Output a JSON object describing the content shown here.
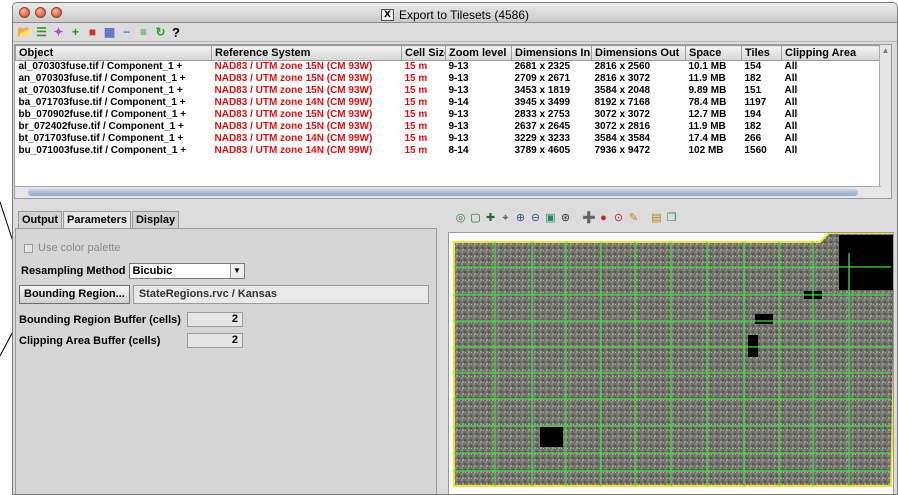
{
  "window": {
    "title": "Export to Tilesets (4586)",
    "x11_glyph": "X"
  },
  "toolbar": {
    "icons": [
      "open-folder-icon",
      "layers-icon",
      "wand-icon",
      "plus-icon",
      "color-blocks-icon",
      "checker-icon",
      "minus-icon",
      "list-icon",
      "refresh-icon"
    ],
    "help": "?"
  },
  "table": {
    "headers": [
      "Object",
      "Reference System",
      "Cell Size",
      "Zoom level",
      "Dimensions In",
      "Dimensions Out",
      "Space",
      "Tiles",
      "Clipping Area"
    ],
    "rows": [
      [
        "al_070303fuse.tif / Component_1 +",
        "NAD83 / UTM zone 15N (CM 93W)",
        "15 m",
        "9-13",
        "2681 x 2325",
        "2816 x 2560",
        "10.1 MB",
        "154",
        "All"
      ],
      [
        "an_070303fuse.tif / Component_1 +",
        "NAD83 / UTM zone 15N (CM 93W)",
        "15 m",
        "9-13",
        "2709 x 2671",
        "2816 x 3072",
        "11.9 MB",
        "182",
        "All"
      ],
      [
        "at_070303fuse.tif / Component_1 +",
        "NAD83 / UTM zone 15N (CM 93W)",
        "15 m",
        "9-13",
        "3453 x 1819",
        "3584 x 2048",
        "9.89 MB",
        "151",
        "All"
      ],
      [
        "ba_071703fuse.tif / Component_1 +",
        "NAD83 / UTM zone 14N (CM 99W)",
        "15 m",
        "9-14",
        "3945 x 3499",
        "8192 x 7168",
        "78.4 MB",
        "1197",
        "All"
      ],
      [
        "bb_070902fuse.tif / Component_1 +",
        "NAD83 / UTM zone 15N (CM 93W)",
        "15 m",
        "9-13",
        "2833 x 2753",
        "3072 x 3072",
        "12.7 MB",
        "194",
        "All"
      ],
      [
        "br_072402fuse.tif / Component_1 +",
        "NAD83 / UTM zone 15N (CM 93W)",
        "15 m",
        "9-13",
        "2637 x 2645",
        "3072 x 2816",
        "11.9 MB",
        "182",
        "All"
      ],
      [
        "bt_071703fuse.tif / Component_1 +",
        "NAD83 / UTM zone 14N (CM 99W)",
        "15 m",
        "9-13",
        "3229 x 3233",
        "3584 x 3584",
        "17.4 MB",
        "266",
        "All"
      ],
      [
        "bu_071003fuse.tif / Component_1 +",
        "NAD83 / UTM zone 14N (CM 99W)",
        "15 m",
        "8-14",
        "3789 x 4605",
        "7936 x 9472",
        "102 MB",
        "1560",
        "All"
      ]
    ]
  },
  "tabs": [
    "Output",
    "Parameters",
    "Display"
  ],
  "params": {
    "use_color_palette": "Use color palette",
    "resampling_label": "Resampling Method",
    "resampling_value": "Bicubic",
    "bounding_button": "Bounding Region...",
    "bounding_value": "StateRegions.rvc / Kansas",
    "bounding_buffer_label": "Bounding Region Buffer (cells)",
    "bounding_buffer_value": "2",
    "clipping_buffer_label": "Clipping Area Buffer (cells)",
    "clipping_buffer_value": "2"
  },
  "view_toolbar": {
    "icons": [
      "globe-icon",
      "select-box-icon",
      "pan-icon",
      "crosshair-icon",
      "zoom-in-icon",
      "zoom-out-icon",
      "zoom-extent-icon",
      "zoom-layer-icon",
      "add-layer-icon",
      "stop-icon",
      "zoom-select-icon",
      "pencil-icon",
      "tile-view-icon",
      "copy-icon"
    ]
  },
  "colors": {
    "accent_red": "#e01010",
    "grid_green": "#3ee03e",
    "boundary_yellow": "#f1e430",
    "image_gray": "#6f6f6a"
  }
}
